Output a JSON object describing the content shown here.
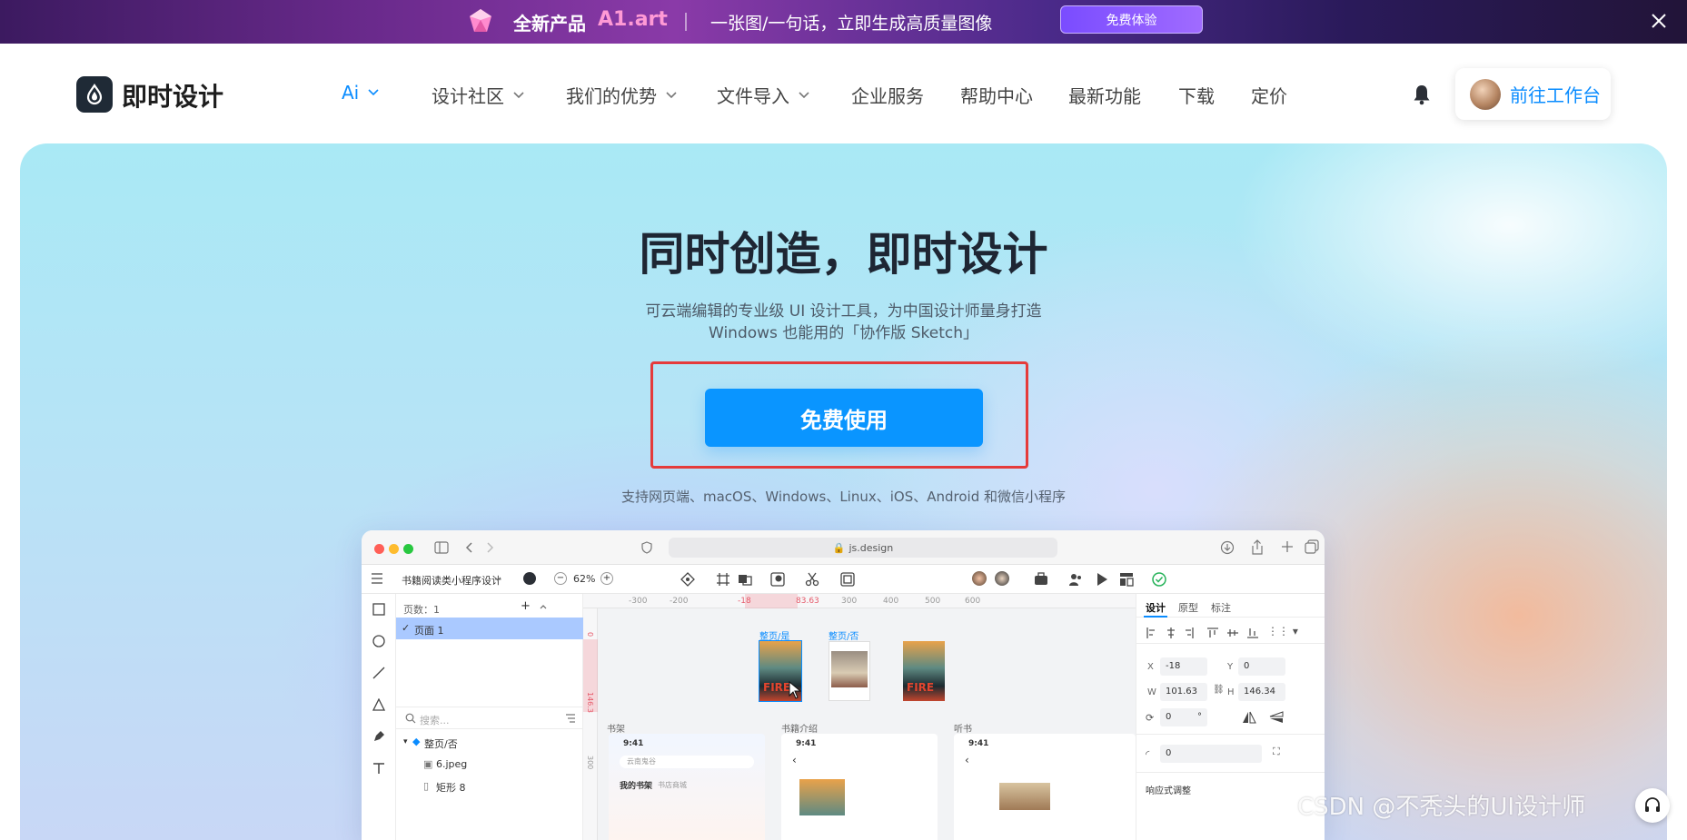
{
  "promo": {
    "product_label": "全新产品",
    "brand": "A1.art",
    "slogan": "一张图/一句话，立即生成高质量图像",
    "cta": "免费体验"
  },
  "nav": {
    "logo_text": "即时设计",
    "items": [
      {
        "label": "Ai",
        "has_dropdown": true,
        "active": true
      },
      {
        "label": "设计社区",
        "has_dropdown": true
      },
      {
        "label": "我们的优势",
        "has_dropdown": true
      },
      {
        "label": "文件导入",
        "has_dropdown": true
      },
      {
        "label": "企业服务",
        "has_dropdown": false
      },
      {
        "label": "帮助中心",
        "has_dropdown": false
      },
      {
        "label": "最新功能",
        "has_dropdown": false
      },
      {
        "label": "下载",
        "has_dropdown": false
      },
      {
        "label": "定价",
        "has_dropdown": false
      }
    ],
    "workbench_label": "前往工作台"
  },
  "hero": {
    "title": "同时创造，即时设计",
    "subtitle_line1": "可云端编辑的专业级 UI 设计工具，为中国设计师量身打造",
    "subtitle_line2": "Windows 也能用的「协作版 Sketch」",
    "cta": "免费使用",
    "platforms": "支持网页端、macOS、Windows、Linux、iOS、Android 和微信小程序"
  },
  "app_preview": {
    "url": "js.design",
    "file_name": "书籍阅读类小程序设计",
    "zoom": "62%",
    "pages_label": "页数：1",
    "page_item": "页面 1",
    "search_placeholder": "搜索...",
    "layers": [
      "整页/否",
      "6.jpeg",
      "矩形 8"
    ],
    "ruler_ticks": [
      "-300",
      "-200",
      "-18",
      "83.63",
      "300",
      "400",
      "500",
      "600"
    ],
    "frame_labels": [
      "整页/是",
      "整页/否"
    ],
    "section_labels": [
      "书架",
      "书籍介绍",
      "听书"
    ],
    "phone_time": "9:41",
    "search_hint": "云南鬼谷",
    "shelf_tabs": [
      "我的书架",
      "书店商城"
    ],
    "cover_text": "FIRE",
    "ruler_v": [
      "0",
      "146.3",
      "300"
    ],
    "props_tabs": [
      "设计",
      "原型",
      "标注"
    ],
    "props": {
      "x_label": "X",
      "x": "-18",
      "y_label": "Y",
      "y": "0",
      "w_label": "W",
      "w": "101.63",
      "h_label": "H",
      "h": "146.34",
      "rotation": "0",
      "rotation_unit": "°",
      "radius": "0",
      "responsive": "响应式调整"
    }
  },
  "watermark": "CSDN @不秃头的UI设计师",
  "colors": {
    "accent": "#0a95ff",
    "highlight_border": "#e53b3b",
    "title": "#1e2633"
  }
}
